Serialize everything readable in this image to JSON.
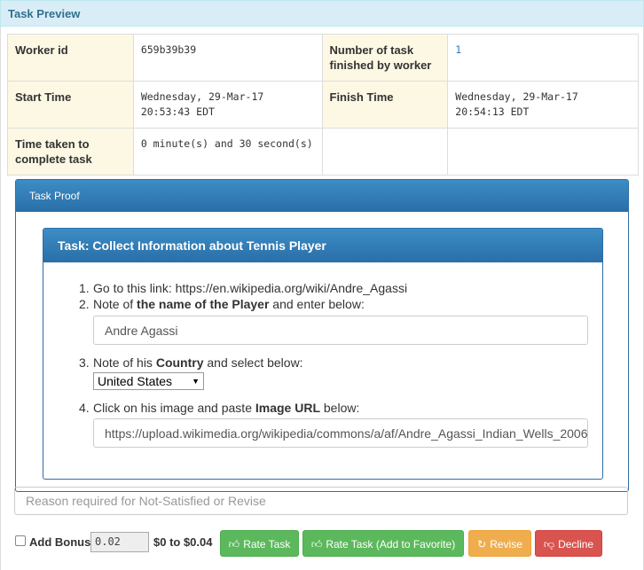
{
  "panel": {
    "title": "Task Preview"
  },
  "info": {
    "worker_id_label": "Worker id",
    "worker_id": "659b39b39",
    "num_tasks_label": "Number of task finished by worker",
    "num_tasks": "1",
    "start_label": "Start Time",
    "start": "Wednesday, 29-Mar-17 20:53:43 EDT",
    "finish_label": "Finish Time",
    "finish": "Wednesday, 29-Mar-17 20:54:13 EDT",
    "duration_label": "Time taken to complete task",
    "duration": "0 minute(s) and 30 second(s)"
  },
  "proof": {
    "title": "Task Proof",
    "task_title": "Task: Collect Information about Tennis Player",
    "step1": "Go to this link: https://en.wikipedia.org/wiki/Andre_Agassi",
    "step2_pre": "Note of ",
    "step2_bold": "the name of the Player",
    "step2_post": " and enter below:",
    "name_value": "Andre  Agassi",
    "step3_pre": "Note of his ",
    "step3_bold": "Country",
    "step3_post": " and select below:",
    "country_value": "United States",
    "step4_pre": "Click on his image and paste ",
    "step4_bold": "Image URL",
    "step4_post": " below:",
    "image_url": "https://upload.wikimedia.org/wikipedia/commons/a/af/Andre_Agassi_Indian_Wells_2006"
  },
  "review": {
    "reason_placeholder": "Reason required for Not-Satisfied or Revise",
    "bonus_label": "Add Bonus",
    "bonus_value": "0.02",
    "bonus_range": "$0 to $0.04",
    "rate_label": "Rate Task",
    "rate_fav_label": "Rate Task (Add to Favorite)",
    "revise_label": "Revise",
    "decline_label": "Decline"
  }
}
